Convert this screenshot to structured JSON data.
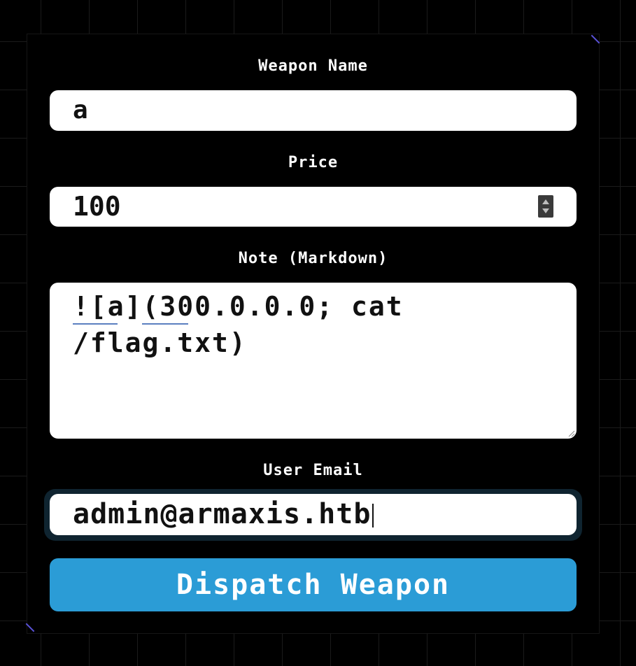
{
  "form": {
    "weapon_name": {
      "label": "Weapon Name",
      "value": "a"
    },
    "price": {
      "label": "Price",
      "value": "100"
    },
    "note": {
      "label": "Note (Markdown)",
      "line1": "![a](300.0.0.0; cat",
      "line2": "/flag.txt)"
    },
    "user_email": {
      "label": "User Email",
      "value": "admin@armaxis.htb"
    },
    "submit_label": "Dispatch Weapon"
  },
  "colors": {
    "background": "#000000",
    "accent_button": "#2b9cd6",
    "corner_accent": "#5a52d8",
    "field_bg": "#ffffff"
  },
  "icons": {
    "price_stepper": "number-spinner-icon",
    "textarea_resize": "resize-handle-icon"
  }
}
